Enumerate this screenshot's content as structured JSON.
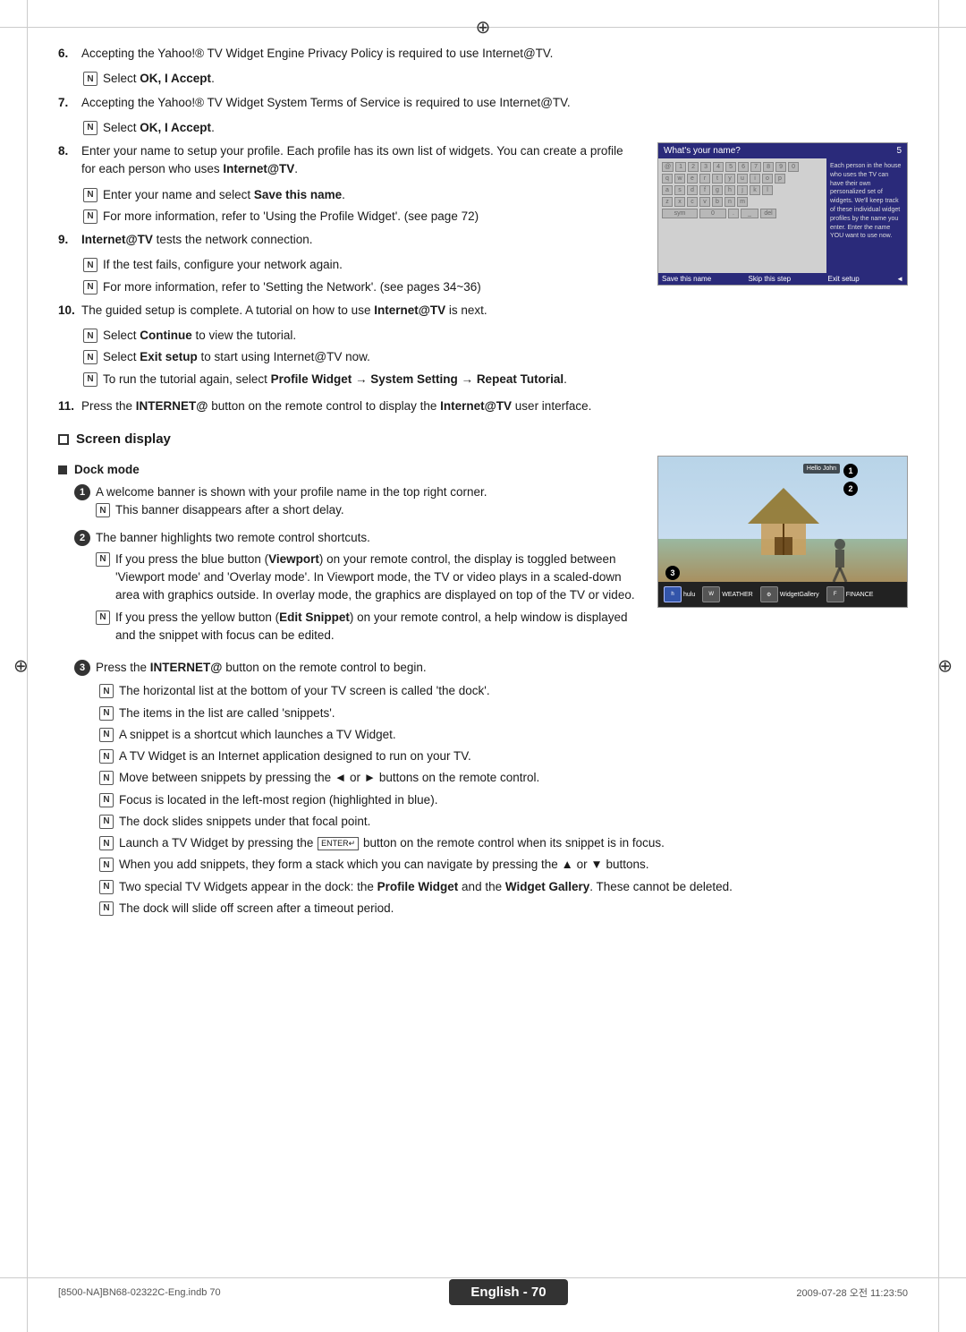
{
  "page": {
    "title": "English 70",
    "footer": {
      "label": "English - 70",
      "left": "[8500-NA]BN68-02322C-Eng.indb  70",
      "right": "2009-07-28   오전 11:23:50"
    }
  },
  "content": {
    "items": [
      {
        "num": "6.",
        "text": "Accepting the Yahoo!® TV Widget Engine Privacy Policy is required to use Internet@TV.",
        "subitems": [
          {
            "text": "Select OK, I Accept.",
            "bold": "OK, I Accept."
          }
        ]
      },
      {
        "num": "7.",
        "text": "Accepting the Yahoo!® TV Widget System Terms of Service is required to use Internet@TV.",
        "subitems": [
          {
            "text": "Select OK, I Accept.",
            "bold": "OK, I Accept."
          }
        ]
      },
      {
        "num": "8.",
        "text_before": "Enter your name to setup your profile. Each profile has its own list of widgets. You can create a profile for each person who uses ",
        "text_bold": "Internet@TV",
        "text_after": ".",
        "subitems": [
          {
            "text": "Enter your name and select Save this name.",
            "bold": "Save this name."
          },
          {
            "text": "For more information, refer to 'Using the Profile Widget'. (see page 72)"
          }
        ]
      },
      {
        "num": "9.",
        "text": "Internet@TV tests the network connection.",
        "text_bold": "Internet@TV",
        "subitems": [
          {
            "text": "If the test fails, configure your network again."
          },
          {
            "text": "For more information, refer to 'Setting the Network'. (see pages 34~36)"
          }
        ]
      },
      {
        "num": "10.",
        "text_before": "The guided setup is complete. A tutorial on how to use ",
        "text_bold": "Internet@TV",
        "text_after": " is next.",
        "subitems": [
          {
            "text": "Select Continue to view the tutorial.",
            "bold": "Continue"
          },
          {
            "text": "Select Exit setup to start using Internet@TV now.",
            "bold": "Exit setup"
          },
          {
            "text": "To run the tutorial again, select Profile Widget → System Setting → Repeat Tutorial.",
            "bold": "Profile Widget → System Setting → Repeat Tutorial."
          }
        ]
      },
      {
        "num": "11.",
        "text_before": "Press the INTERNET@ button on the remote control to display the ",
        "text_bold": "INTERNET@",
        "text_middle": " button on the remote control to display the ",
        "text_bold2": "Internet@TV",
        "text_after": " user interface."
      }
    ],
    "screen_display": {
      "title": "Screen display",
      "dock_mode": {
        "title": "Dock mode",
        "items": [
          {
            "num": "1",
            "text": "A welcome banner is shown with your profile name in the top right corner.",
            "subitems": [
              {
                "text": "This banner disappears after a short delay."
              }
            ]
          },
          {
            "num": "2",
            "text": "The banner highlights two remote control shortcuts.",
            "subitems": [
              {
                "text": "If you press the blue button (Viewport) on your remote control, the display is toggled between 'Viewport mode' and 'Overlay mode'. In Viewport mode, the TV or video plays in a scaled-down area with graphics outside. In overlay mode, the graphics are displayed on top of the TV or video.",
                "bold": "Viewport"
              },
              {
                "text": "If you press the yellow button (Edit Snippet) on your remote control, a help window is displayed and the snippet with focus can be edited.",
                "bold": "Edit Snippet"
              }
            ]
          },
          {
            "num": "3",
            "text": "Press the INTERNET@ button on the remote control to begin.",
            "bold": "INTERNET@",
            "subitems": [
              {
                "text": "The horizontal list at the bottom of your TV screen is called 'the dock'."
              },
              {
                "text": "The items in the list are called 'snippets'."
              },
              {
                "text": "A snippet is a shortcut which launches a TV Widget."
              },
              {
                "text": "A TV Widget is an Internet application designed to run on your TV."
              },
              {
                "text": "Move between snippets by pressing the ◄ or ► buttons on the remote control."
              },
              {
                "text": "Focus is located in the left-most region (highlighted in blue)."
              },
              {
                "text": "The dock slides snippets under that focal point."
              },
              {
                "text": "Launch a TV Widget by pressing the ENTER button on the remote control when its snippet is in focus."
              },
              {
                "text": "When you add snippets, they form a stack which you can navigate by pressing the ▲ or ▼ buttons."
              },
              {
                "text": "Two special TV Widgets appear in the dock: the Profile Widget and the Widget Gallery. These cannot be deleted.",
                "bold1": "Profile Widget",
                "bold2": "Widget Gallery"
              },
              {
                "text": "The dock will slide off screen after a timeout period."
              }
            ]
          }
        ]
      }
    },
    "image_top": {
      "title": "What's your name?",
      "number": "5",
      "sidebar_text": "Each person in the house who uses the TV can have their own personalized set of widgets. We'll keep track of these individual widget profiles by the name you enter. Enter the name YOU want to use now.",
      "footer_items": [
        "Save this name",
        "Skip this step",
        "Exit setup"
      ]
    },
    "image_beach": {
      "dock_items": [
        "hulu",
        "WEATHER",
        "WidgetGallery",
        "FINANCE"
      ]
    }
  }
}
